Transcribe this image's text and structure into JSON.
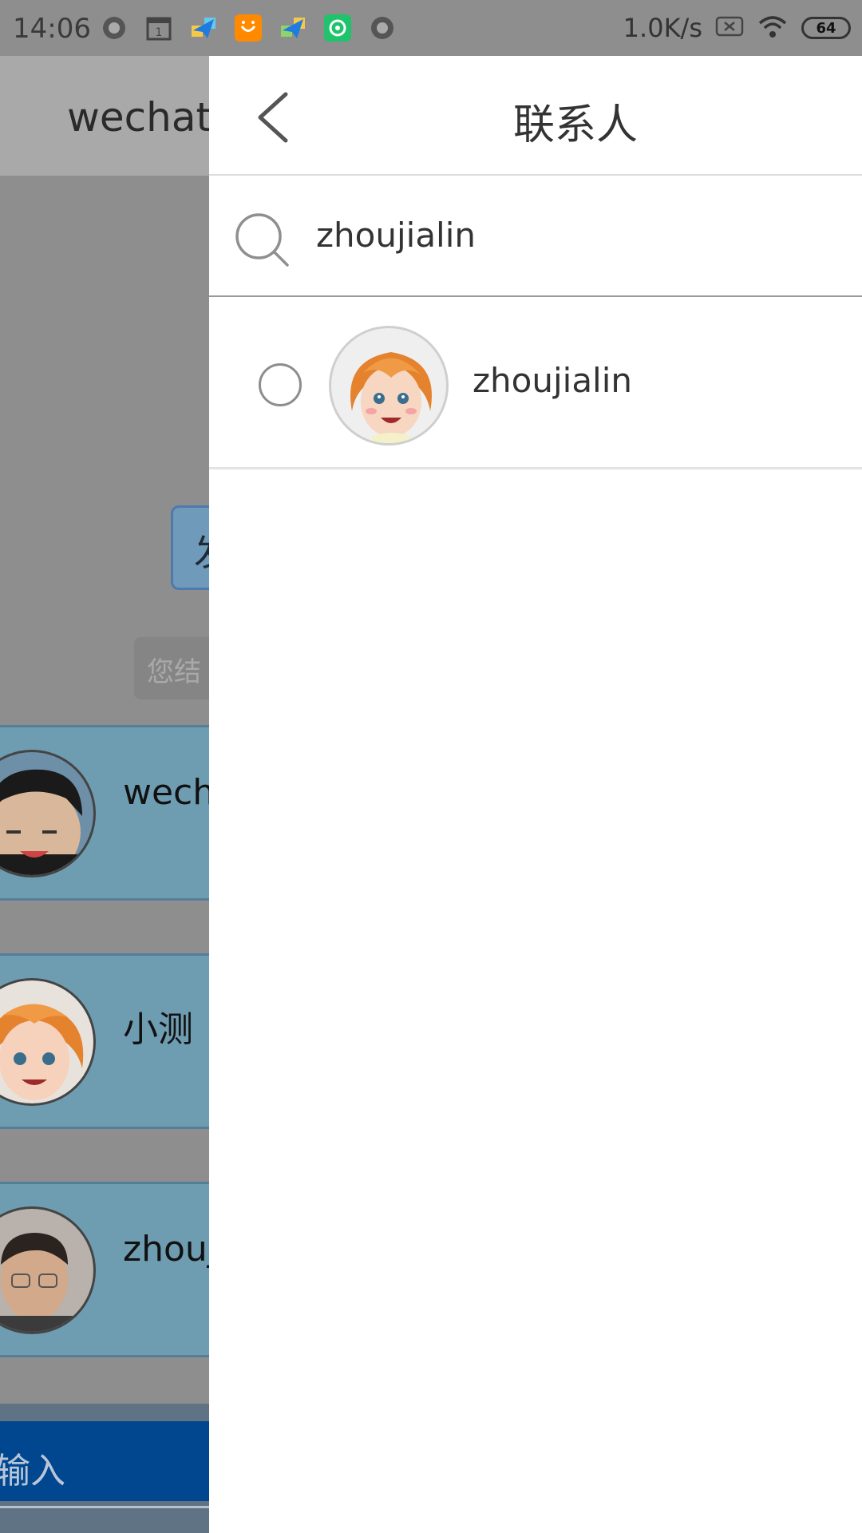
{
  "status_bar": {
    "time": "14:06",
    "net_speed": "1.0K/s",
    "battery": "64",
    "icons": [
      "record-icon",
      "calendar-icon",
      "paper-plane-icon",
      "taobao-icon",
      "paper-plane-icon",
      "app-icon",
      "record-icon"
    ]
  },
  "background": {
    "header_title": "wechat_",
    "bubble_text": "发",
    "notice_text": "您结",
    "cards": [
      {
        "name": "wech"
      },
      {
        "name": "小测"
      },
      {
        "name": "zhouj"
      }
    ],
    "input_placeholder": "输入"
  },
  "drawer": {
    "title": "联系人",
    "search": {
      "value": "zhoujialin",
      "icon": "search-icon"
    },
    "contacts": [
      {
        "name": "zhoujialin",
        "selected": false
      }
    ]
  },
  "colors": {
    "drawer_bg": "#ffffff",
    "overlay": "#8e8e8e",
    "card_bg": "#6e9db2",
    "input_bar": "#00478f"
  }
}
